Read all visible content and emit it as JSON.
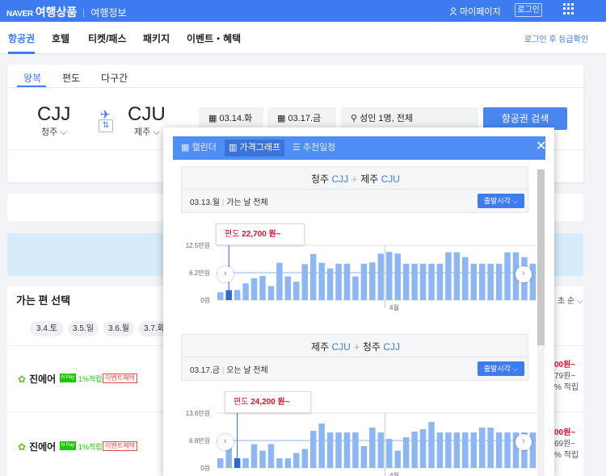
{
  "header": {
    "brand_small": "NAVER",
    "brand": "여행상품",
    "subtitle": "여행정보",
    "mypage": "마이페이지",
    "login": "로그인"
  },
  "nav": {
    "items": [
      "항공권",
      "호텔",
      "티켓/패스",
      "패키지",
      "이벤트・혜택"
    ],
    "right": "로그인 후 등급확인"
  },
  "search": {
    "trip_tabs": [
      "왕복",
      "편도",
      "다구간"
    ],
    "from_code": "CJJ",
    "from_city": "청주",
    "to_code": "CJU",
    "to_city": "제주",
    "depart_date": "03.14.화",
    "return_date": "03.17.금",
    "passengers": "성인 1명, 전체",
    "search_button": "항공권 검색"
  },
  "results": {
    "title": "가는 편 선택",
    "sort": "초 순",
    "date_chips": [
      "3.4.토",
      "3.5.일",
      "3.6.월",
      "3.7.화"
    ],
    "rows": [
      {
        "airline": "진에어",
        "pay": "N Pay",
        "pct": "1%적립",
        "event": "이벤트혜택",
        "price": "00원~",
        "sub1": "79원~",
        "sub2": "% 적립"
      },
      {
        "airline": "진에어",
        "pay": "N Pay",
        "pct": "1%적립",
        "event": "이벤트혜택",
        "price": "00원~",
        "sub1": "69원~",
        "sub2": "% 적립"
      }
    ]
  },
  "popup": {
    "tabs": [
      "캘린더",
      "가격그래프",
      "추천일정"
    ],
    "outbound": {
      "from_city": "청주",
      "from_code": "CJJ",
      "to_city": "제주",
      "to_code": "CJU",
      "date": "03.13.월",
      "date_note": "가는 날 전체",
      "dropdown": "출발시각",
      "tooltip_prefix": "편도",
      "tooltip_price": "22,700 원~",
      "month_label": "4월"
    },
    "inbound": {
      "from_city": "제주",
      "from_code": "CJU",
      "to_city": "청주",
      "to_code": "CJJ",
      "date": "03.17.금",
      "date_note": "오는 날 전체",
      "dropdown": "출발시각",
      "tooltip_prefix": "편도",
      "tooltip_price": "24,200 원~",
      "month_label": "4월"
    }
  },
  "colors": {
    "accent": "#3d7bf0",
    "bar": "#8cb6f4",
    "bar_selected": "#3168cf",
    "price_red": "#e0102b"
  },
  "chart_data": [
    {
      "type": "bar",
      "yticks": [
        "12.5만원",
        "6.2만원",
        "0원"
      ],
      "ylim": [
        0,
        12.5
      ],
      "unit": "만원",
      "month_label": "4월",
      "values": [
        1.8,
        2.27,
        2.3,
        3.8,
        5.0,
        5.5,
        3.2,
        8.5,
        5.4,
        4.2,
        8.2,
        10.5,
        8.5,
        7.2,
        8.3,
        8.3,
        5.4,
        8.3,
        8.6,
        10.6,
        11.0,
        10.6,
        8.3,
        8.3,
        8.3,
        8.3,
        8.3,
        10.9,
        10.9,
        9.8,
        8.3,
        8.3,
        8.3,
        8.3,
        10.9,
        10.9,
        9.8,
        8.3
      ],
      "selected_index": 1
    },
    {
      "type": "bar",
      "yticks": [
        "13.6만원",
        "6.8만원",
        "0원"
      ],
      "ylim": [
        0,
        13.6
      ],
      "unit": "만원",
      "month_label": "4월",
      "values": [
        2.4,
        5.8,
        2.42,
        2.4,
        5.9,
        4.3,
        5.9,
        2.4,
        2.4,
        3.7,
        4.7,
        9.2,
        11.0,
        8.8,
        8.8,
        8.8,
        8.8,
        5.4,
        10.0,
        8.8,
        7.2,
        4.3,
        7.6,
        9.0,
        9.6,
        11.4,
        8.8,
        8.8,
        8.8,
        8.8,
        8.8,
        10.0,
        10.0,
        8.8,
        8.8,
        8.8,
        8.8,
        8.8
      ],
      "selected_index": 2
    }
  ]
}
